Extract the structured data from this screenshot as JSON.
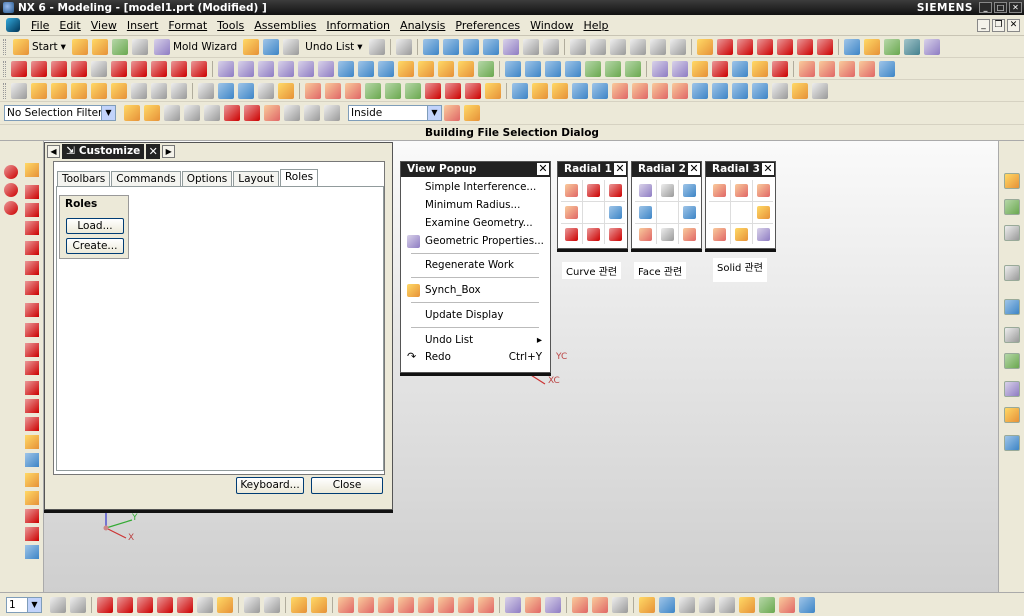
{
  "window": {
    "title": "NX 6 - Modeling - [model1.prt (Modified) ]",
    "brand": "SIEMENS",
    "controls": [
      "_",
      "□",
      "✕"
    ]
  },
  "menubar": {
    "items": [
      "File",
      "Edit",
      "View",
      "Insert",
      "Format",
      "Tools",
      "Assemblies",
      "Information",
      "Analysis",
      "Preferences",
      "Window",
      "Help"
    ]
  },
  "toolbar": {
    "start_label": "Start",
    "mold_wizard_label": "Mold Wizard",
    "undo_list_label": "Undo List",
    "selection_filter_value": "No Selection Filter",
    "scope_value": "Inside"
  },
  "cue_line": "Building File Selection Dialog",
  "customize": {
    "title": "Customize",
    "tabs": [
      "Toolbars",
      "Commands",
      "Options",
      "Layout",
      "Roles"
    ],
    "active_tab": "Roles",
    "roles_group_title": "Roles",
    "load_button": "Load...",
    "create_button": "Create...",
    "keyboard_button": "Keyboard...",
    "close_button": "Close"
  },
  "view_popup": {
    "title": "View Popup",
    "items": [
      {
        "label": "Simple Interference..."
      },
      {
        "label": "Minimum Radius..."
      },
      {
        "label": "Examine Geometry..."
      },
      {
        "label": "Geometric Properties..."
      },
      {
        "label": "Regenerate Work"
      },
      {
        "label": "Synch_Box"
      },
      {
        "label": "Update Display"
      },
      {
        "label": "Undo List"
      },
      {
        "label": "Redo",
        "accelerator": "Ctrl+Y"
      }
    ]
  },
  "radials": [
    {
      "title": "Radial 1",
      "label": "Curve 관련"
    },
    {
      "title": "Radial 2",
      "label": "Face 관련"
    },
    {
      "title": "Radial 3",
      "label": "Solid 관련"
    }
  ],
  "axes": {
    "yc": "YC",
    "xc": "XC",
    "y": "Y",
    "x": "X"
  },
  "bottombar": {
    "layer_value": "1"
  }
}
